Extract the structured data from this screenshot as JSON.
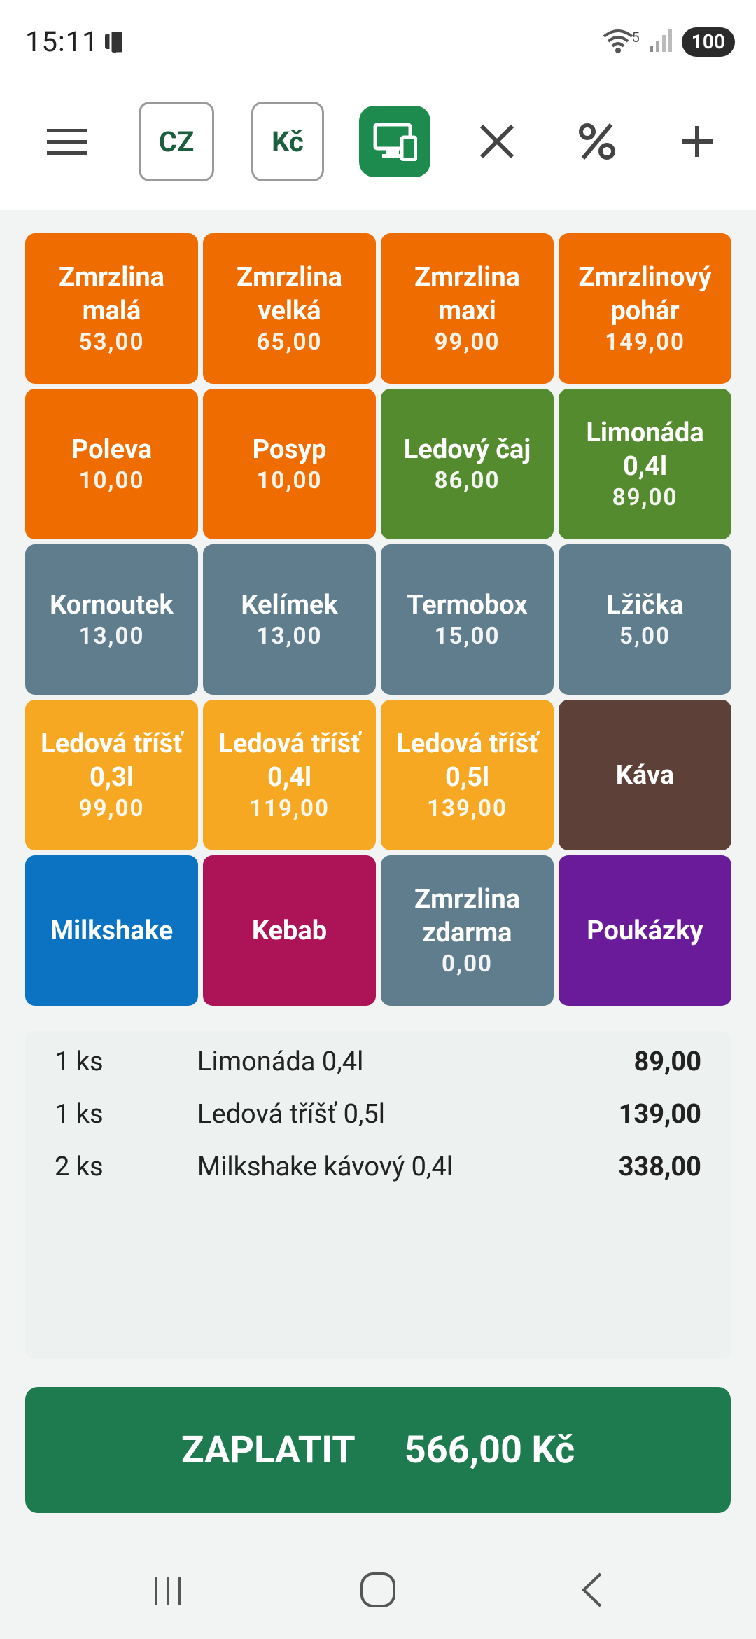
{
  "status": {
    "time": "15:11",
    "battery": "100",
    "network_badge": "5"
  },
  "toolbar": {
    "language": "CZ",
    "currency": "Kč"
  },
  "products": [
    {
      "name": "Zmrzlina\nmalá",
      "price": "53,00",
      "color": "orange"
    },
    {
      "name": "Zmrzlina\nvelká",
      "price": "65,00",
      "color": "orange"
    },
    {
      "name": "Zmrzlina\nmaxi",
      "price": "99,00",
      "color": "orange"
    },
    {
      "name": "Zmrzlinový\npohár",
      "price": "149,00",
      "color": "orange"
    },
    {
      "name": "Poleva",
      "price": "10,00",
      "color": "orange"
    },
    {
      "name": "Posyp",
      "price": "10,00",
      "color": "orange"
    },
    {
      "name": "Ledový čaj",
      "price": "86,00",
      "color": "green"
    },
    {
      "name": "Limonáda\n0,4l",
      "price": "89,00",
      "color": "green"
    },
    {
      "name": "Kornoutek",
      "price": "13,00",
      "color": "slate"
    },
    {
      "name": "Kelímek",
      "price": "13,00",
      "color": "slate"
    },
    {
      "name": "Termobox",
      "price": "15,00",
      "color": "slate"
    },
    {
      "name": "Lžička",
      "price": "5,00",
      "color": "slate"
    },
    {
      "name": "Ledová tříšť\n0,3l",
      "price": "99,00",
      "color": "amber"
    },
    {
      "name": "Ledová tříšť\n0,4l",
      "price": "119,00",
      "color": "amber"
    },
    {
      "name": "Ledová tříšť\n0,5l",
      "price": "139,00",
      "color": "amber"
    },
    {
      "name": "Káva",
      "price": "",
      "color": "brown"
    },
    {
      "name": "Milkshake",
      "price": "",
      "color": "blue"
    },
    {
      "name": "Kebab",
      "price": "",
      "color": "pink"
    },
    {
      "name": "Zmrzlina\nzdarma",
      "price": "0,00",
      "color": "slate"
    },
    {
      "name": "Poukázky",
      "price": "",
      "color": "purple"
    }
  ],
  "order": {
    "items": [
      {
        "qty": "1 ks",
        "name": "Limonáda 0,4l",
        "price": "89,00"
      },
      {
        "qty": "1 ks",
        "name": "Ledová tříšť 0,5l",
        "price": "139,00"
      },
      {
        "qty": "2 ks",
        "name": "Milkshake kávový 0,4l",
        "price": "338,00"
      }
    ]
  },
  "pay": {
    "label": "ZAPLATIT",
    "total": "566,00 Kč"
  },
  "colors": {
    "accent": "#1e7a4f",
    "orange": "#ef6c00",
    "green": "#558b2f",
    "slate": "#5f7d8c",
    "amber": "#f7a823",
    "brown": "#5d4037",
    "blue": "#0b73c1",
    "pink": "#ad1457",
    "purple": "#6a1b9a"
  }
}
